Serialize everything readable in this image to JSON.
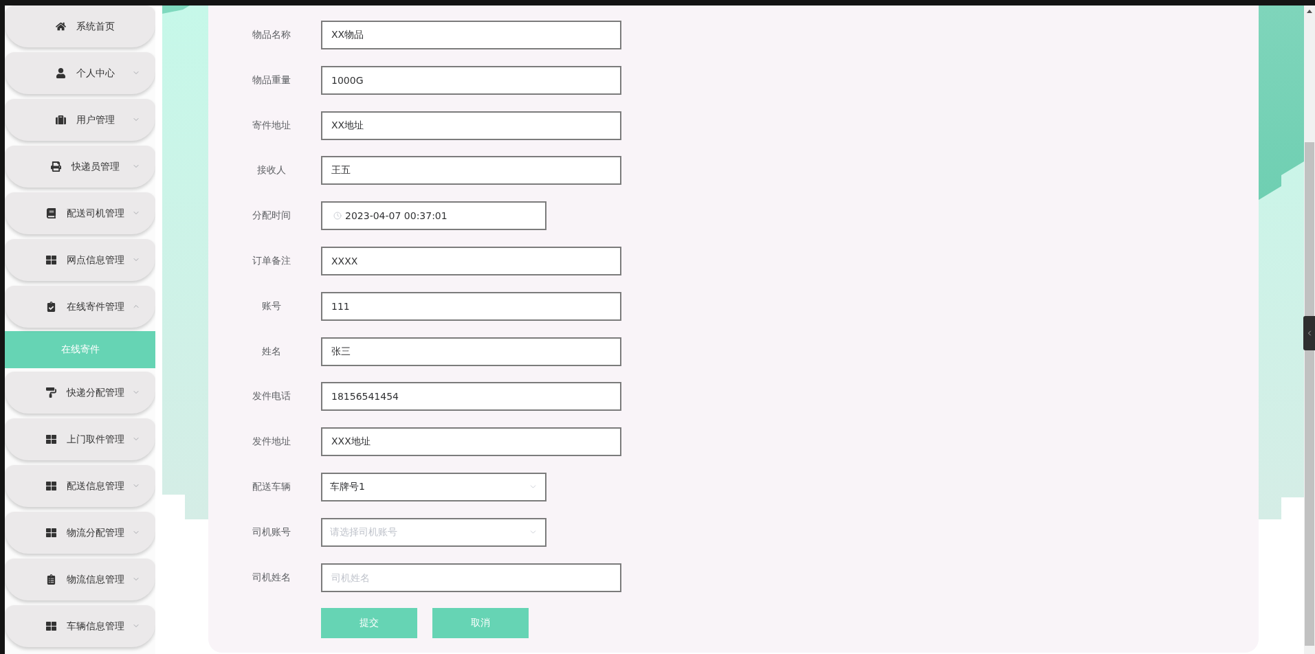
{
  "sidebar": {
    "items": [
      {
        "label": "系统首页",
        "kind": "link",
        "selected": false
      },
      {
        "label": "个人中心",
        "kind": "submenu",
        "expanded": false
      },
      {
        "label": "用户管理",
        "kind": "submenu",
        "expanded": false
      },
      {
        "label": "快递员管理",
        "kind": "submenu",
        "expanded": false
      },
      {
        "label": "配送司机管理",
        "kind": "submenu",
        "expanded": false
      },
      {
        "label": "网点信息管理",
        "kind": "submenu",
        "expanded": false
      },
      {
        "label": "在线寄件管理",
        "kind": "submenu",
        "expanded": true,
        "children": [
          {
            "label": "在线寄件",
            "selected": true
          }
        ]
      },
      {
        "label": "快递分配管理",
        "kind": "submenu",
        "expanded": false
      },
      {
        "label": "上门取件管理",
        "kind": "submenu",
        "expanded": false
      },
      {
        "label": "配送信息管理",
        "kind": "submenu",
        "expanded": false
      },
      {
        "label": "物流分配管理",
        "kind": "submenu",
        "expanded": false
      },
      {
        "label": "物流信息管理",
        "kind": "submenu",
        "expanded": false
      },
      {
        "label": "车辆信息管理",
        "kind": "submenu",
        "expanded": false
      }
    ]
  },
  "form": {
    "fields": [
      {
        "label": "物品名称",
        "kind": "text",
        "value": "XX物品"
      },
      {
        "label": "物品重量",
        "kind": "text",
        "value": "1000G"
      },
      {
        "label": "寄件地址",
        "kind": "text",
        "value": "XX地址"
      },
      {
        "label": "接收人",
        "kind": "text",
        "value": "王五"
      },
      {
        "label": "分配时间",
        "kind": "date",
        "value": "2023-04-07 00:37:01"
      },
      {
        "label": "订单备注",
        "kind": "text",
        "value": "XXXX"
      },
      {
        "label": "账号",
        "kind": "text",
        "value": "111"
      },
      {
        "label": "姓名",
        "kind": "text",
        "value": "张三"
      },
      {
        "label": "发件电话",
        "kind": "text",
        "value": "18156541454"
      },
      {
        "label": "发件地址",
        "kind": "text",
        "value": "XXX地址"
      },
      {
        "label": "配送车辆",
        "kind": "select",
        "value": "车牌号1"
      },
      {
        "label": "司机账号",
        "kind": "select",
        "placeholder": "请选择司机账号"
      },
      {
        "label": "司机姓名",
        "kind": "text",
        "placeholder": "司机姓名"
      }
    ],
    "buttons": [
      "提交",
      "取消"
    ]
  }
}
